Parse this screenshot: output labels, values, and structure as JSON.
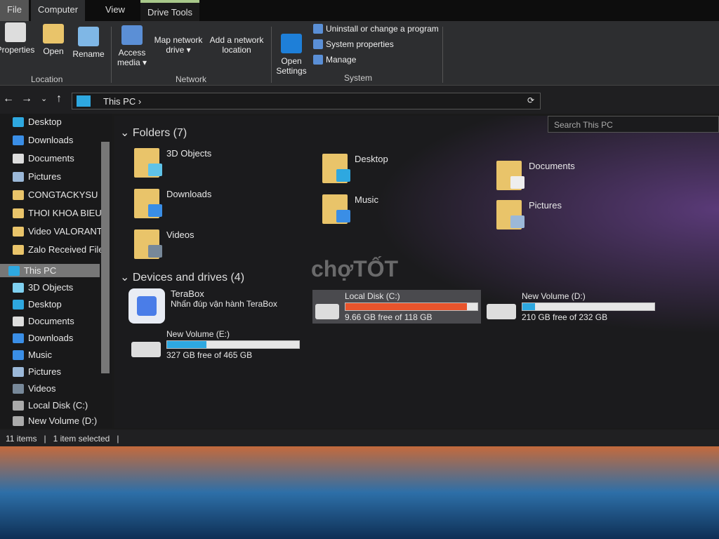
{
  "tabs": [
    "File",
    "Computer",
    "View",
    "Drive Tools"
  ],
  "ribbon": {
    "location": {
      "label": "Location",
      "buttons": [
        "Properties",
        "Open",
        "Rename"
      ]
    },
    "network": {
      "label": "Network",
      "buttons": [
        "Access media ▾",
        "Map network drive ▾",
        "Add a network location"
      ]
    },
    "system": {
      "label": "System",
      "open_settings": "Open Settings",
      "items": [
        "Uninstall or change a program",
        "System properties",
        "Manage"
      ]
    }
  },
  "address": {
    "path": "This PC",
    "separator": "›",
    "search_placeholder": "Search This PC"
  },
  "sidebar": {
    "quick_access": [
      {
        "label": "Desktop",
        "pinned": true
      },
      {
        "label": "Downloads",
        "pinned": true
      },
      {
        "label": "Documents",
        "pinned": true
      },
      {
        "label": "Pictures",
        "pinned": true
      },
      {
        "label": "CONGTACKYSU"
      },
      {
        "label": "THOI KHOA BIEU"
      },
      {
        "label": "Video VALORANT"
      },
      {
        "label": "Zalo Received Files"
      }
    ],
    "this_pc": "This PC",
    "this_pc_items": [
      "3D Objects",
      "Desktop",
      "Documents",
      "Downloads",
      "Music",
      "Pictures",
      "Videos",
      "Local Disk (C:)",
      "New Volume (D:)"
    ]
  },
  "folders": {
    "title": "Folders (7)",
    "items": [
      "3D Objects",
      "Desktop",
      "Documents",
      "Downloads",
      "Music",
      "Pictures",
      "Videos"
    ]
  },
  "drives": {
    "title": "Devices and drives (4)",
    "terabox": {
      "name": "TeraBox",
      "subtitle": "Nhấn đúp vận hành TeraBox"
    },
    "items": [
      {
        "name": "Local Disk (C:)",
        "info": "9.66 GB free of 118 GB",
        "used_fraction": 0.918,
        "color": "#e8542c",
        "selected": true
      },
      {
        "name": "New Volume (D:)",
        "info": "210 GB free of 232 GB",
        "used_fraction": 0.095,
        "color": "#2ea8e0"
      },
      {
        "name": "New Volume (E:)",
        "info": "327 GB free of 465 GB",
        "used_fraction": 0.297,
        "color": "#2ea8e0"
      }
    ]
  },
  "status": {
    "count": "11 items",
    "selected": "1 item selected"
  },
  "watermark": "chợTỐT"
}
